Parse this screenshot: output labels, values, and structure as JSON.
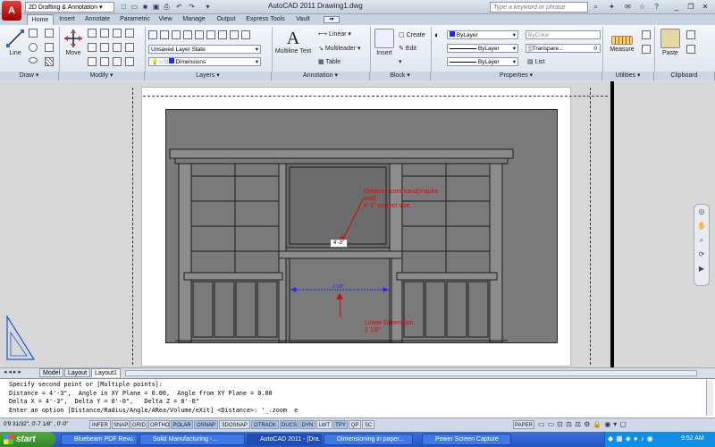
{
  "titlebar": {
    "app_icon": "autocad-a-icon",
    "workspace": "2D Drafting & Annotation",
    "title": "AutoCAD 2011    Drawing1.dwg",
    "search_placeholder": "Type a keyword or phrase"
  },
  "tabs": [
    "Home",
    "Insert",
    "Annotate",
    "Parametric",
    "View",
    "Manage",
    "Output",
    "Express Tools",
    "Vault"
  ],
  "ribbon": {
    "draw": {
      "title": "Draw",
      "line": "Line"
    },
    "modify": {
      "title": "Modify",
      "move": "Move"
    },
    "layers": {
      "title": "Layers",
      "layer_state": "Unsaved Layer State",
      "current_layer": "Dimensions"
    },
    "annotation": {
      "title": "Annotation",
      "multiline_text": "Multiline Text",
      "linear": "Linear",
      "multileader": "Multileader",
      "table": "Table"
    },
    "block": {
      "title": "Block",
      "insert": "Insert",
      "create": "Create",
      "edit": "Edit"
    },
    "properties": {
      "title": "Properties",
      "color": "ByLayer",
      "linetype": "ByLayer",
      "lineweight": "ByLayer",
      "plot_style": "ByColor",
      "transparency": "Transpare...",
      "transparency_value": "0",
      "list": "List"
    },
    "utilities": {
      "title": "Utilities",
      "measure": "Measure"
    },
    "clipboard": {
      "title": "Clipboard",
      "paste": "Paste"
    }
  },
  "drawing": {
    "note1": [
      "Distance command(inquire",
      "tool)",
      "4'-1\" correct size."
    ],
    "dim_value": "4'-3\"",
    "linear_dim_value": "2 1/8\"",
    "note2": [
      "Linear Dimension",
      "2 1/8\""
    ]
  },
  "layout_tabs": [
    "Model",
    "Layout",
    "Layout1"
  ],
  "command_lines": [
    "Specify second point or [Multiple points]:",
    "Distance = 4'-3\",  Angle in XY Plane = 0.00,  Angle from XY Plane = 0.00",
    "Delta X = 4'-3\",  Delta Y = 0'-0\",   Delta Z = 0'-0\"",
    "Enter an option [Distance/Radius/Angle/ARea/Volume/eXit] <Distance>: '_.zoom  e"
  ],
  "status": {
    "coords": "0'9 31/32\", 0'-7 1/8\" , 0'-0\"",
    "toggles": [
      "INFER",
      "SNAP",
      "GRID",
      "ORTHO",
      "POLAR",
      "OSNAP",
      "3DOSNAP",
      "OTRACK",
      "DUCS",
      "DYN",
      "LWT",
      "TPY",
      "QP",
      "SC"
    ],
    "space": "PAPER"
  },
  "taskbar": {
    "start": "start",
    "tasks": [
      "Bluebeam PDF Revu",
      "Solid Manufacturing -...",
      "AutoCAD 2011 - [Dra...",
      "Dimensioning in paper...",
      "Power Screen Capture"
    ],
    "active_task": 2,
    "clock": "9:52 AM"
  },
  "colors": {
    "dim_blue": "#1a2bff",
    "note_red": "#e00000",
    "bookcase_dark": "#3a3a3a"
  }
}
